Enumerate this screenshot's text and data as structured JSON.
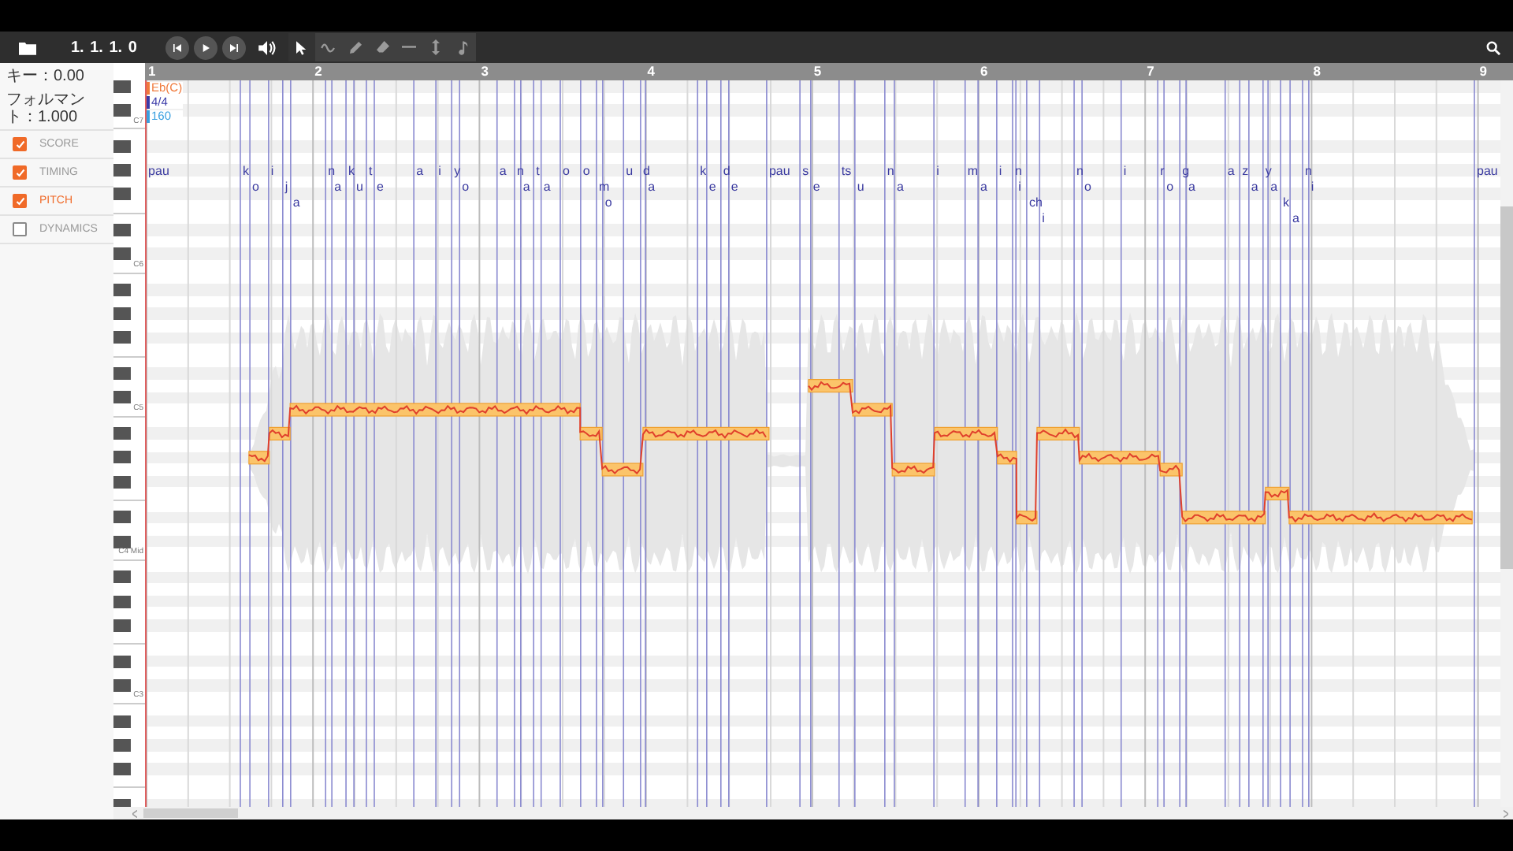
{
  "toolbar": {
    "position": "1. 1. 1. 0",
    "transport": [
      {
        "kind": "previous"
      },
      {
        "kind": "play"
      },
      {
        "kind": "next"
      }
    ],
    "tools": [
      {
        "kind": "pointer",
        "selected": true
      },
      {
        "kind": "curve",
        "selected": false
      },
      {
        "kind": "pencil",
        "selected": false
      },
      {
        "kind": "eraser",
        "selected": false
      },
      {
        "kind": "line",
        "selected": false
      },
      {
        "kind": "vertical",
        "selected": false
      },
      {
        "kind": "note",
        "selected": false
      }
    ]
  },
  "sidebar": {
    "key": "キー：0.00",
    "formant": "フォルマント：1.000",
    "tracks": [
      {
        "label": "SCORE",
        "checked": true,
        "selected": false
      },
      {
        "label": "TIMING",
        "checked": true,
        "selected": false
      },
      {
        "label": "PITCH",
        "checked": true,
        "selected": true
      },
      {
        "label": "DYNAMICS",
        "checked": false,
        "selected": false
      }
    ]
  },
  "piano": {
    "octave_labels": [
      "C7",
      "C6",
      "C5",
      "C4 Mid",
      "C3"
    ]
  },
  "ruler": {
    "measures": [
      "1",
      "2",
      "3",
      "4",
      "5",
      "6",
      "7",
      "8",
      "9"
    ]
  },
  "markers": [
    {
      "text": "Eb(C)",
      "color": "#f07a3c"
    },
    {
      "text": "4/4",
      "color": "#3a3aa8"
    },
    {
      "text": "160",
      "color": "#3aa0e0"
    }
  ],
  "phonemes": [
    "pau",
    "k",
    "o",
    "i",
    "j",
    "a",
    "n",
    "a",
    "k",
    "u",
    "t",
    "e",
    "a",
    "i",
    "y",
    "o",
    "a",
    "n",
    "a",
    "t",
    "a",
    "o",
    "o",
    "m",
    "o",
    "u",
    "d",
    "a",
    "k",
    "e",
    "d",
    "e",
    "pau",
    "s",
    "e",
    "ts",
    "u",
    "n",
    "a",
    "i",
    "m",
    "a",
    "i",
    "n",
    "i",
    "ch",
    "i",
    "n",
    "o",
    "i",
    "r",
    "o",
    "g",
    "a",
    "a",
    "z",
    "a",
    "y",
    "a",
    "k",
    "a",
    "n",
    "i",
    "pau"
  ]
}
